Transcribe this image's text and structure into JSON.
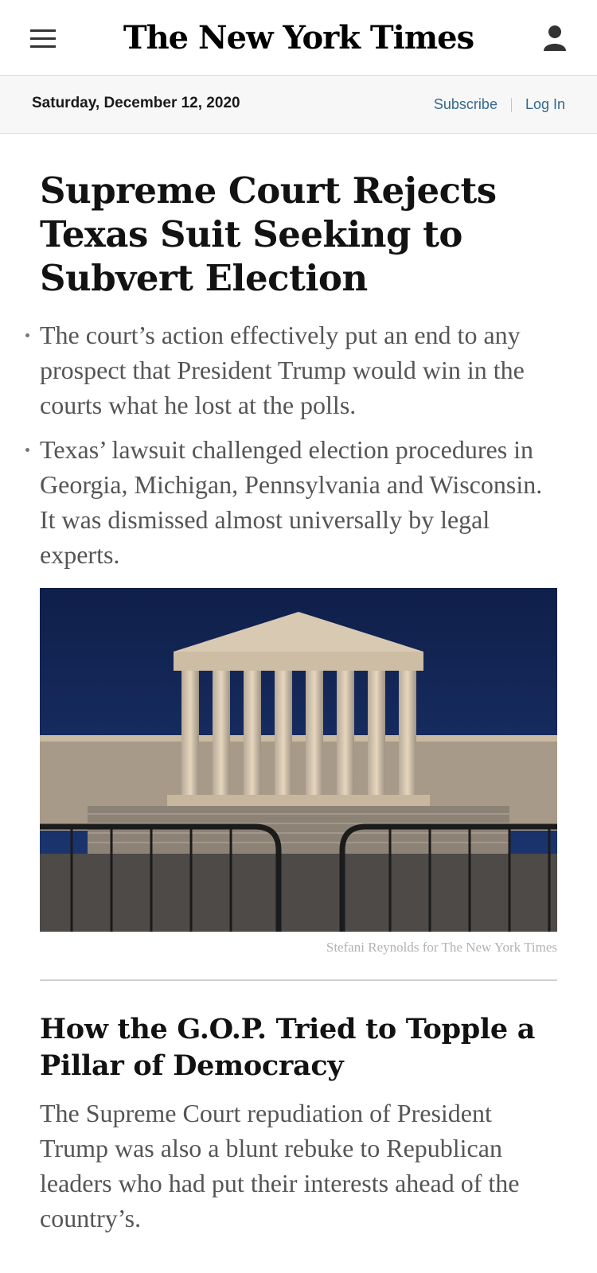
{
  "header": {
    "logo_text": "The New York Times",
    "menu_icon": "hamburger-menu-icon",
    "account_icon": "user-account-icon"
  },
  "subbar": {
    "date": "Saturday, December 12, 2020",
    "subscribe_label": "Subscribe",
    "login_label": "Log In",
    "link_color": "#326891"
  },
  "article": {
    "headline": "Supreme Court Rejects Texas Suit Seeking to Subvert Election",
    "bullets": [
      "The court’s action effectively put an end to any prospect that President Trump would win in the courts what he lost at the polls.",
      "Texas’ lawsuit challenged election procedures in Georgia, Michigan, Pennsylvania and Wisconsin. It was dismissed almost universally by legal experts."
    ],
    "photo_credit": "Stefani Reynolds for The New York Times"
  },
  "second_story": {
    "headline": "How the G.O.P. Tried to Topple a Pillar of Democracy",
    "summary": "The Supreme Court repudiation of President Trump was also a blunt rebuke to Republican leaders who had put their interests ahead of the country’s."
  }
}
